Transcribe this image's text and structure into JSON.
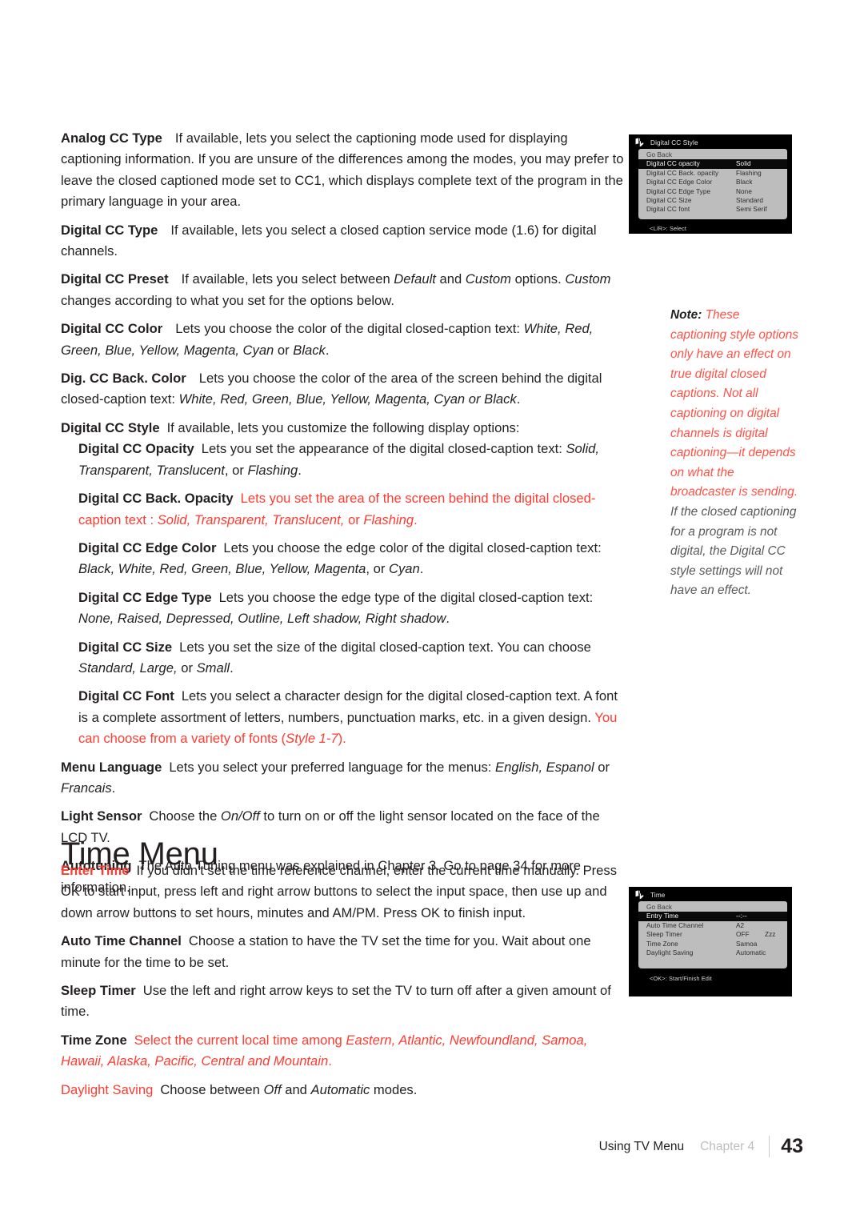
{
  "page": {
    "number": "43",
    "footer_title": "Using TV Menu",
    "footer_chapter": "Chapter 4"
  },
  "section": {
    "title": "Time Menu"
  },
  "entries": [
    {
      "label": "Analog CC Type",
      "text": "If available, lets you select the captioning mode used for displaying captioning information. If you are unsure of the differences among the modes, you may prefer to leave the closed captioned mode set to CC1, which displays complete text of the program in the primary language in your area."
    },
    {
      "label": "Digital CC Type",
      "text": "If available, lets you select a closed caption service mode (1.6) for digital channels."
    },
    {
      "label": "Digital CC Preset",
      "text_a": "If available, lets you select between ",
      "em_a": "Default",
      "text_b": " and ",
      "em_b": "Custom",
      "text_c": " options. ",
      "em_c": "Custom",
      "text_d": " changes according to what you set for the options below."
    },
    {
      "label": "Digital CC Color",
      "text_a": "Lets you choose the color of the digital closed-caption text: ",
      "em_a": "White, Red, Green, Blue, Yellow, Magenta, Cyan",
      "text_b": " or ",
      "em_b": "Black",
      "text_c": "."
    },
    {
      "label": "Dig. CC Back. Color",
      "text_a": "Lets you choose the color of the area of the screen behind the digital closed-caption text: ",
      "em_a": "White, Red, Green, Blue, Yellow, Magenta, Cyan or Black",
      "text_b": "."
    },
    {
      "label": "Digital CC Style",
      "text": "If available, lets you customize the following display options:"
    }
  ],
  "sub_entries": [
    {
      "label": "Digital CC Opacity",
      "text_a": "Lets you set the appearance of the digital closed-caption text: ",
      "em_a": "Solid,  Transparent, Translucent",
      "text_b": ", or ",
      "em_b": "Flashing",
      "text_c": "."
    },
    {
      "label": "Digital CC Back. Opacity",
      "text_a": "Lets you set the area of the screen behind the digital closed-caption text : ",
      "em_a": "Solid, Transparent, Translucent,",
      "text_b": " or ",
      "em_b": "Flashing",
      "text_c": ".",
      "red": true
    },
    {
      "label": "Digital CC Edge Color",
      "text_a": "Lets you choose the edge color of the  digital closed-caption text: ",
      "em_a": "Black, White, Red, Green, Blue, Yellow, Magenta",
      "text_b": ", or ",
      "em_b": "Cyan",
      "text_c": "."
    },
    {
      "label": "Digital CC Edge Type",
      "text_a": "Lets you choose the edge type of the  digital closed-caption text: ",
      "em_a": "None, Raised, Depressed, Outline, Left shadow, Right shadow",
      "text_b": "."
    },
    {
      "label": "Digital CC Size",
      "text_a": "Lets you set the size of the digital closed-caption text. You can choose ",
      "em_a": "Standard, Large,",
      "text_b": " or ",
      "em_b": "Small",
      "text_c": "."
    },
    {
      "label": "Digital CC Font",
      "text_a": "Lets you select a character design for the digital closed-caption text. A font is a complete assortment of letters, numbers, punctuation marks, etc. in a given design. ",
      "red_a": "You can choose from a variety of fonts (",
      "red_em": "Style 1-7",
      "red_b": ")."
    }
  ],
  "entries_tail": [
    {
      "label": "Menu Language",
      "text_a": "Lets you select your preferred language for the menus: ",
      "em_a": "English, Espanol",
      "text_b": " or ",
      "em_b": "Francais",
      "text_c": "."
    },
    {
      "label": "Light Sensor",
      "text_a": "Choose the ",
      "em_a": "On/Off",
      "text_b": " to turn on or off the light sensor located on the face of the LCD TV."
    },
    {
      "label": "Autotuning",
      "text": "The Auto Tuning menu was explained in Chapter 3. Go to page 34 for more information."
    }
  ],
  "time_entries": [
    {
      "label": "Enter Time",
      "label_red": true,
      "text": "If you didn't set the time reference channel, enter the current time manually. Press OK to start input, press left and right arrow buttons to select the input space, then use up and down arrow buttons to set hours, minutes and AM/PM. Press OK to finish input."
    },
    {
      "label": "Auto Time Channel",
      "text": "Choose a station to have the TV set the time for you. Wait about one minute for the time to be set."
    },
    {
      "label": "Sleep Timer",
      "text": "Use the left and right arrow keys to set the TV to turn off after a given amount of time."
    },
    {
      "label": "Time Zone",
      "text_a": "Select the current local time among ",
      "em_a": "Eastern, Atlantic, Newfoundland, Samoa, Hawaii, Alaska, Pacific, Central and Mountain",
      "text_b": ".",
      "red": true
    },
    {
      "label": "Daylight Saving",
      "label_red": true,
      "text_a": "Choose between ",
      "em_a": "Off",
      "text_b": " and ",
      "em_b": "Automatic",
      "text_c": " modes."
    }
  ],
  "note": {
    "prefix": "Note:",
    "red_text": " These captioning style options only have an effect on true digital closed captions. Not all captioning on digital channels is digital captioning—it depends on what the broadcaster is sending.",
    "grey_text": " If the closed captioning for a program is not digital, the Digital CC style settings will not have an effect."
  },
  "osd_cc": {
    "title": "Digital CC Style",
    "go_back": "Go Back",
    "rows": [
      {
        "key": "Digital CC opacity",
        "value": "Solid",
        "selected": true
      },
      {
        "key": "Digital CC Back. opacity",
        "value": "Flashing",
        "selected": false
      },
      {
        "key": "Digital CC Edge Color",
        "value": "Black",
        "selected": false
      },
      {
        "key": "Digital CC Edge Type",
        "value": "None",
        "selected": false
      },
      {
        "key": "Digital CC Size",
        "value": "Standard",
        "selected": false
      },
      {
        "key": "Digital CC font",
        "value": "Semi Serif",
        "selected": false
      }
    ],
    "footer": "<L/R>: Select"
  },
  "osd_time": {
    "title": "Time",
    "go_back": "Go Back",
    "rows": [
      {
        "key": "Entry Time",
        "value": "--:--",
        "value2": "",
        "selected": true
      },
      {
        "key": "Auto Time Channel",
        "value": "A2",
        "value2": "",
        "selected": false
      },
      {
        "key": "Sleep Timer",
        "value": "OFF",
        "value2": "Zzz",
        "selected": false
      },
      {
        "key": "Time Zone",
        "value": "Samoa",
        "value2": "",
        "selected": false
      },
      {
        "key": "Daylight Saving",
        "value": "Automatic",
        "value2": "",
        "selected": false
      }
    ],
    "footer": "<OK>: Start/Finish Edit"
  },
  "colors": {
    "red": "#ff3b30",
    "body": "#231f20",
    "note_grey": "#58595b"
  }
}
